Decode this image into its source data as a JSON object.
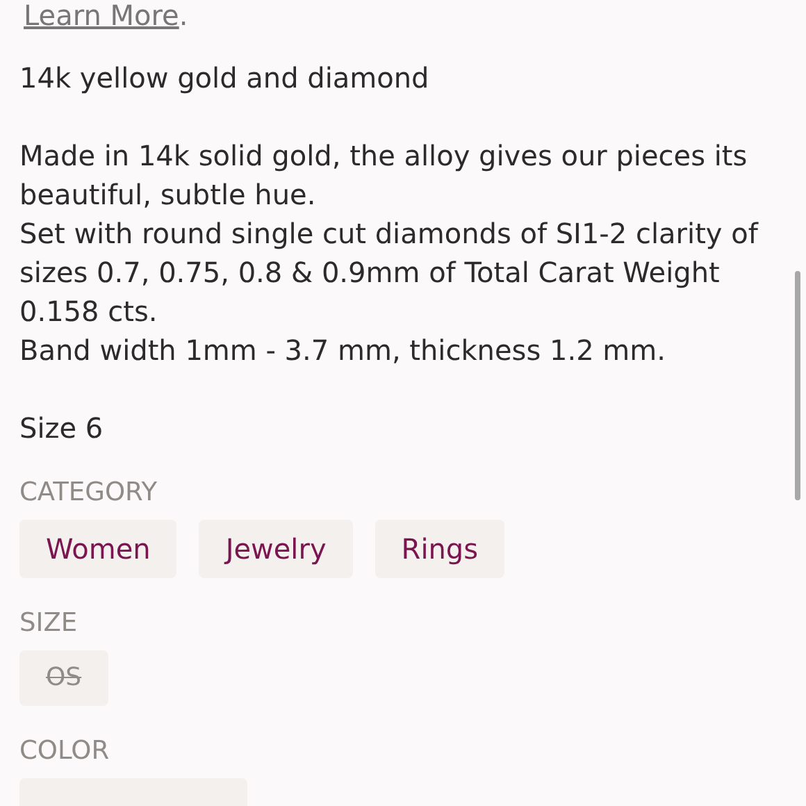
{
  "learn_more": {
    "link": "Learn More",
    "after": "."
  },
  "title": "14k yellow gold and diamond",
  "description": [
    "Made in 14k solid gold, the alloy gives our pieces its beautiful, subtle hue.",
    "Set with round single cut diamonds of SI1-2 clarity of sizes 0.7, 0.75, 0.8 & 0.9mm of Total Carat Weight 0.158 cts.",
    "Band width 1mm - 3.7 mm, thickness 1.2 mm."
  ],
  "size_note": "Size 6",
  "sections": [
    {
      "heading": "CATEGORY",
      "tags": [
        {
          "label": "Women",
          "unavailable": false
        },
        {
          "label": "Jewelry",
          "unavailable": false
        },
        {
          "label": "Rings",
          "unavailable": false
        }
      ]
    },
    {
      "heading": "SIZE",
      "tags": [
        {
          "label": "OS",
          "unavailable": true
        }
      ]
    },
    {
      "heading": "COLOR"
    }
  ]
}
